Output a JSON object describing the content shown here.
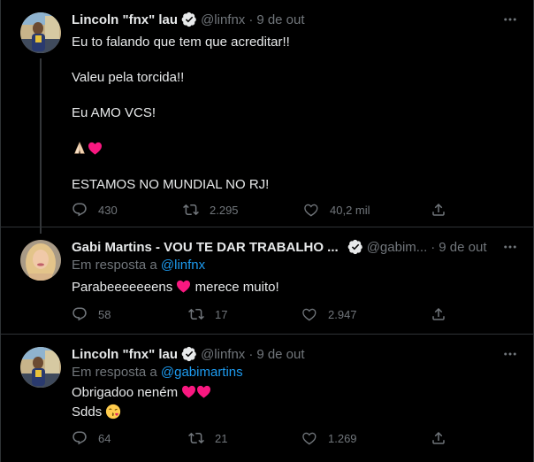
{
  "tweets": [
    {
      "name": "Lincoln \"fnx\" lau",
      "handle": "@linfnx",
      "separator": "·",
      "date": "9 de out",
      "lines": [
        "Eu to falando que tem que acreditar!!",
        "Valeu pela torcida!!",
        "Eu AMO VCS!",
        "ESTAMOS NO MUNDIAL NO RJ!"
      ],
      "replies": "430",
      "retweets": "2.295",
      "likes": "40,2 mil"
    },
    {
      "name": "Gabi Martins - VOU TE DAR TRABALHO ...",
      "handle": "@gabim...",
      "separator": "·",
      "date": "9 de out",
      "reply_prefix": "Em resposta a ",
      "reply_to": "@linfnx",
      "text_before_heart": "Parabeeeeeeens",
      "text_after_heart": " merece muito!",
      "replies": "58",
      "retweets": "17",
      "likes": "2.947"
    },
    {
      "name": "Lincoln \"fnx\" lau",
      "handle": "@linfnx",
      "separator": "·",
      "date": "9 de out",
      "reply_prefix": "Em resposta a ",
      "reply_to": "@gabimartins",
      "line1": "Obrigadoo neném",
      "line2": "Sdds",
      "replies": "64",
      "retweets": "21",
      "likes": "1.269"
    }
  ],
  "colors": {
    "background": "#000000",
    "text": "#e7e9ea",
    "muted": "#71767b",
    "link": "#1d9bf0",
    "heart": "#f91880",
    "divider": "#2f3336"
  },
  "icons": [
    "verified-badge-icon",
    "more-icon",
    "reply-icon",
    "retweet-icon",
    "like-icon",
    "share-icon",
    "folded-hands-emoji",
    "red-heart-emoji",
    "kissing-face-emoji"
  ]
}
